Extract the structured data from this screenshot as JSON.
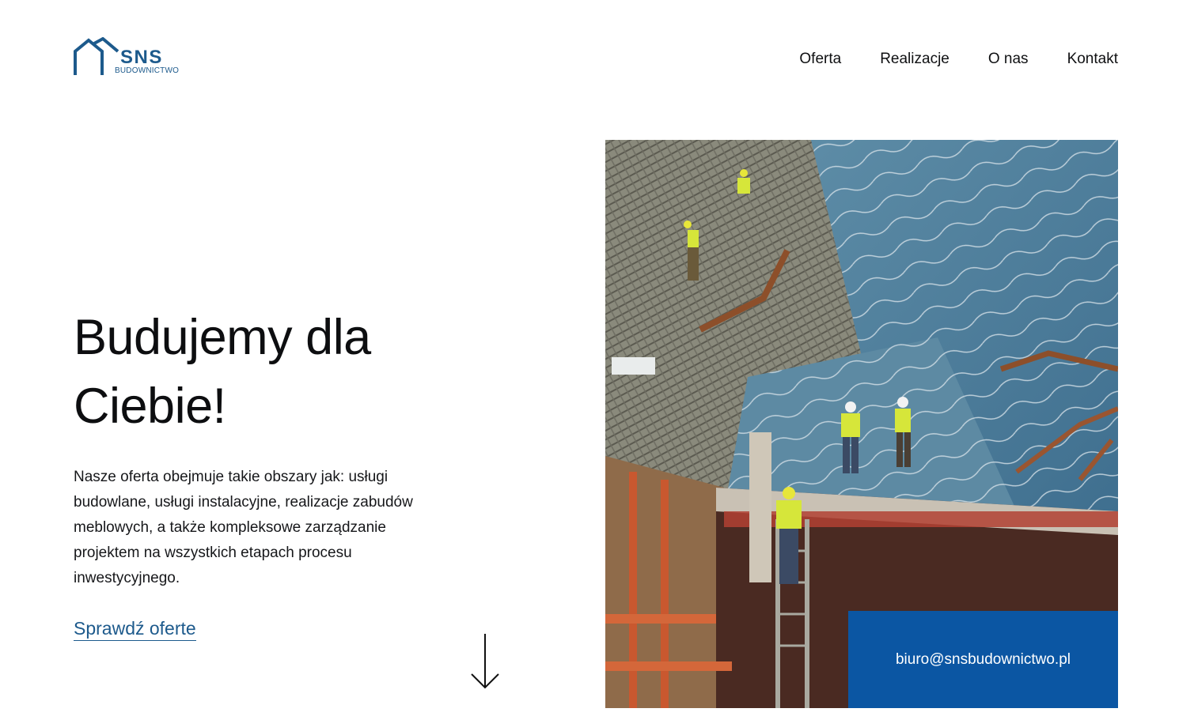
{
  "brand": {
    "name": "SNS",
    "subtitle": "BUDOWNICTWO",
    "color": "#1d5a8c"
  },
  "nav": {
    "items": [
      "Oferta",
      "Realizacje",
      "O nas",
      "Kontakt"
    ]
  },
  "hero": {
    "title_line1": "Budujemy dla",
    "title_line2": "Ciebie!",
    "description": "Nasze oferta obejmuje takie obszary jak: usługi budowlane, usługi instalacyjne, realizacje zabudów meblowych, a także kompleksowe zarządzanie projektem na wszystkich etapach procesu inwestycyjnego.",
    "cta_label": "Sprawdź oferte",
    "image_alt": "construction-site-photo"
  },
  "contact": {
    "email": "biuro@snsbudownictwo.pl",
    "box_color": "#0b56a3"
  },
  "icons": {
    "scroll": "arrow-down-icon",
    "logo": "house-roof-logo-icon"
  }
}
